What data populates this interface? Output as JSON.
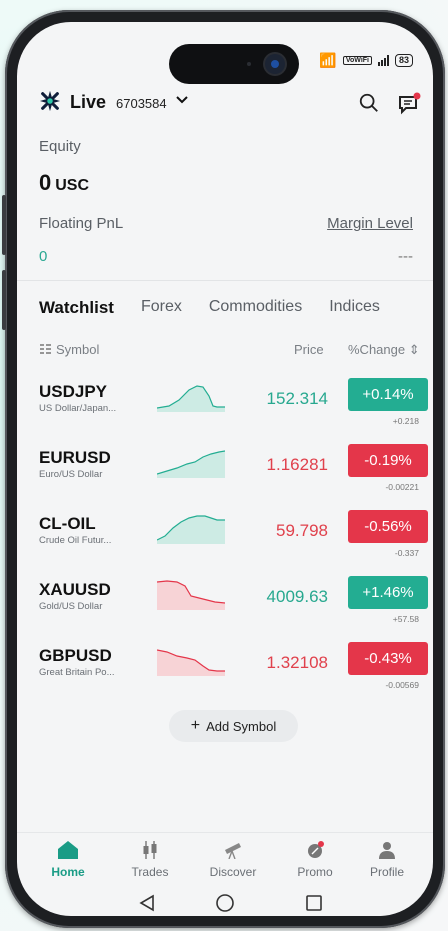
{
  "status": {
    "wifi_label": "VoWiFi",
    "battery": "83"
  },
  "header": {
    "mode": "Live",
    "account_number": "6703584"
  },
  "summary": {
    "equity_label": "Equity",
    "equity_value": "0",
    "equity_currency": "USC",
    "floating_pnl_label": "Floating PnL",
    "floating_pnl_value": "0",
    "margin_level_label": "Margin Level",
    "margin_level_value": "---"
  },
  "tabs": [
    "Watchlist",
    "Forex",
    "Commodities",
    "Indices"
  ],
  "columns": {
    "symbol": "Symbol",
    "price": "Price",
    "change": "%Change"
  },
  "watchlist": [
    {
      "symbol": "USDJPY",
      "name": "US Dollar/Japan...",
      "price": "152.314",
      "change": "+0.14%",
      "change_abs": "+0.218",
      "direction": "up"
    },
    {
      "symbol": "EURUSD",
      "name": "Euro/US Dollar",
      "price": "1.16281",
      "change": "-0.19%",
      "change_abs": "-0.00221",
      "direction": "down"
    },
    {
      "symbol": "CL-OIL",
      "name": "Crude Oil Futur...",
      "price": "59.798",
      "change": "-0.56%",
      "change_abs": "-0.337",
      "direction": "down"
    },
    {
      "symbol": "XAUUSD",
      "name": "Gold/US Dollar",
      "price": "4009.63",
      "change": "+1.46%",
      "change_abs": "+57.58",
      "direction": "up"
    },
    {
      "symbol": "GBPUSD",
      "name": "Great Britain Po...",
      "price": "1.32108",
      "change": "-0.43%",
      "change_abs": "-0.00569",
      "direction": "down"
    }
  ],
  "add_symbol": "Add Symbol",
  "nav": [
    {
      "label": "Home",
      "icon": "home-icon"
    },
    {
      "label": "Trades",
      "icon": "trades-icon"
    },
    {
      "label": "Discover",
      "icon": "telescope-icon"
    },
    {
      "label": "Promo",
      "icon": "promo-icon"
    },
    {
      "label": "Profile",
      "icon": "profile-icon"
    }
  ],
  "colors": {
    "accent": "#1a9c86",
    "up": "#23ad92",
    "down": "#e4364a"
  }
}
